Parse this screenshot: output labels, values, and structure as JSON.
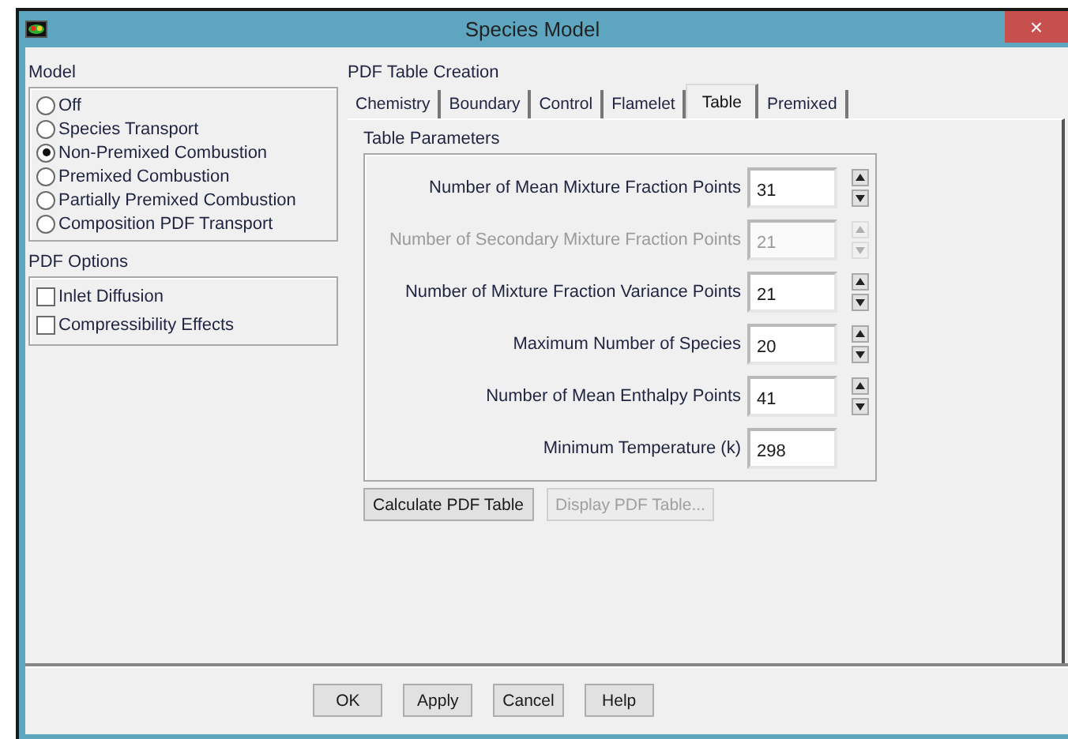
{
  "window": {
    "title": "Species Model",
    "close": "×"
  },
  "model": {
    "title": "Model",
    "options": [
      {
        "label": "Off",
        "selected": false
      },
      {
        "label": "Species Transport",
        "selected": false
      },
      {
        "label": "Non-Premixed Combustion",
        "selected": true
      },
      {
        "label": "Premixed Combustion",
        "selected": false
      },
      {
        "label": "Partially Premixed Combustion",
        "selected": false
      },
      {
        "label": "Composition PDF Transport",
        "selected": false
      }
    ]
  },
  "pdf_options": {
    "title": "PDF Options",
    "items": [
      {
        "label": "Inlet Diffusion",
        "checked": false
      },
      {
        "label": "Compressibility Effects",
        "checked": false
      }
    ]
  },
  "pdf_table_creation": {
    "title": "PDF Table Creation",
    "tabs": [
      {
        "label": "Chemistry",
        "selected": false
      },
      {
        "label": "Boundary",
        "selected": false
      },
      {
        "label": "Control",
        "selected": false
      },
      {
        "label": "Flamelet",
        "selected": false
      },
      {
        "label": "Table",
        "selected": true
      },
      {
        "label": "Premixed",
        "selected": false
      }
    ],
    "table_parameters": {
      "title": "Table Parameters",
      "rows": [
        {
          "label": "Number of Mean Mixture Fraction Points",
          "value": "31",
          "kind": "spinner",
          "disabled": false
        },
        {
          "label": "Number of Secondary Mixture Fraction Points",
          "value": "21",
          "kind": "spinner",
          "disabled": true
        },
        {
          "label": "Number of Mixture Fraction Variance Points",
          "value": "21",
          "kind": "spinner",
          "disabled": false
        },
        {
          "label": "Maximum Number of Species",
          "value": "20",
          "kind": "spinner",
          "disabled": false
        },
        {
          "label": "Number of Mean Enthalpy Points",
          "value": "41",
          "kind": "spinner",
          "disabled": false
        },
        {
          "label": "Minimum Temperature (k)",
          "value": "298",
          "kind": "plain",
          "disabled": false
        }
      ]
    },
    "actions": [
      {
        "label": "Calculate PDF Table",
        "disabled": false
      },
      {
        "label": "Display PDF Table...",
        "disabled": true
      }
    ]
  },
  "buttons": [
    "OK",
    "Apply",
    "Cancel",
    "Help"
  ]
}
